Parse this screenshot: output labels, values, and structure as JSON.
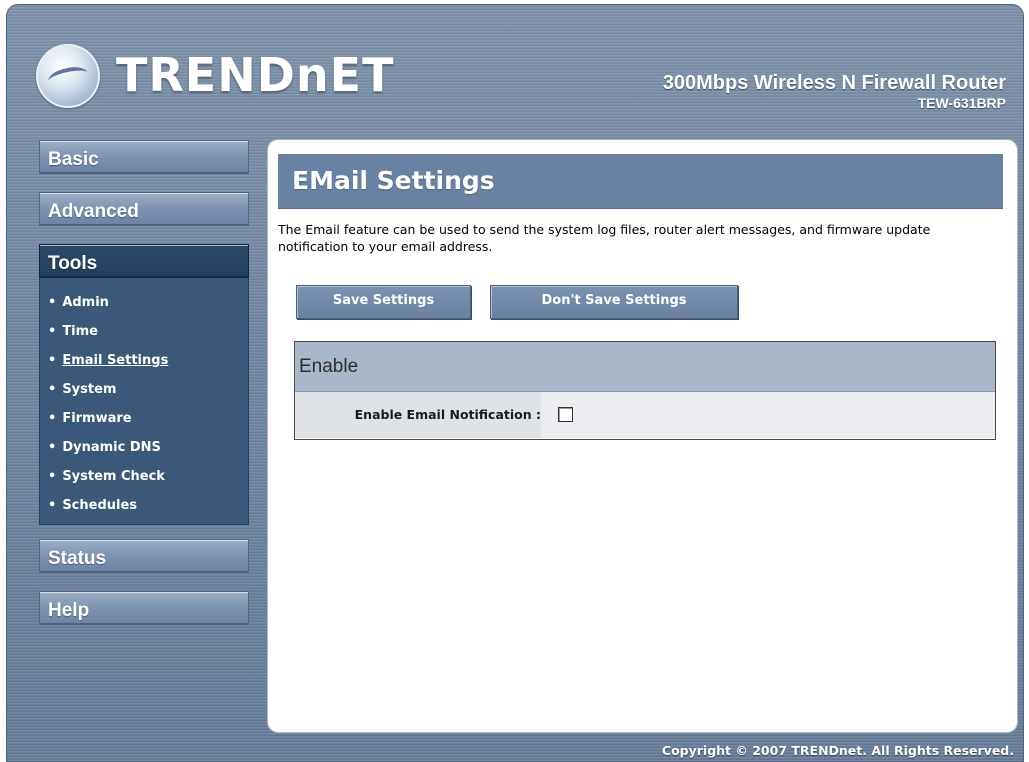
{
  "header": {
    "brand": "TRENDnET",
    "product_title": "300Mbps Wireless N Firewall Router",
    "model": "TEW-631BRP"
  },
  "sidebar": {
    "items": [
      {
        "label": "Basic"
      },
      {
        "label": "Advanced"
      },
      {
        "label": "Tools"
      },
      {
        "label": "Status"
      },
      {
        "label": "Help"
      }
    ],
    "tools_submenu": [
      {
        "label": "Admin"
      },
      {
        "label": "Time"
      },
      {
        "label": "Email Settings"
      },
      {
        "label": "System"
      },
      {
        "label": "Firmware"
      },
      {
        "label": "Dynamic DNS"
      },
      {
        "label": "System Check"
      },
      {
        "label": "Schedules"
      }
    ],
    "current_submenu": "Email Settings"
  },
  "main": {
    "title": "EMail Settings",
    "description": "The Email feature can be used to send the system log files, router alert messages, and firmware update notification to your email address.",
    "buttons": {
      "save": "Save Settings",
      "dont_save": "Don't Save Settings"
    },
    "section": {
      "title": "Enable",
      "field_label": "Enable Email Notification :",
      "checked": false
    }
  },
  "footer": {
    "copyright": "Copyright © 2007 TRENDnet. All Rights Reserved."
  },
  "colors": {
    "frame": "#6f849f",
    "title_bar": "#6a82a2",
    "active_nav": "#2c4968",
    "submenu_bg": "#3b5878",
    "section_head": "#a9b7c9"
  }
}
